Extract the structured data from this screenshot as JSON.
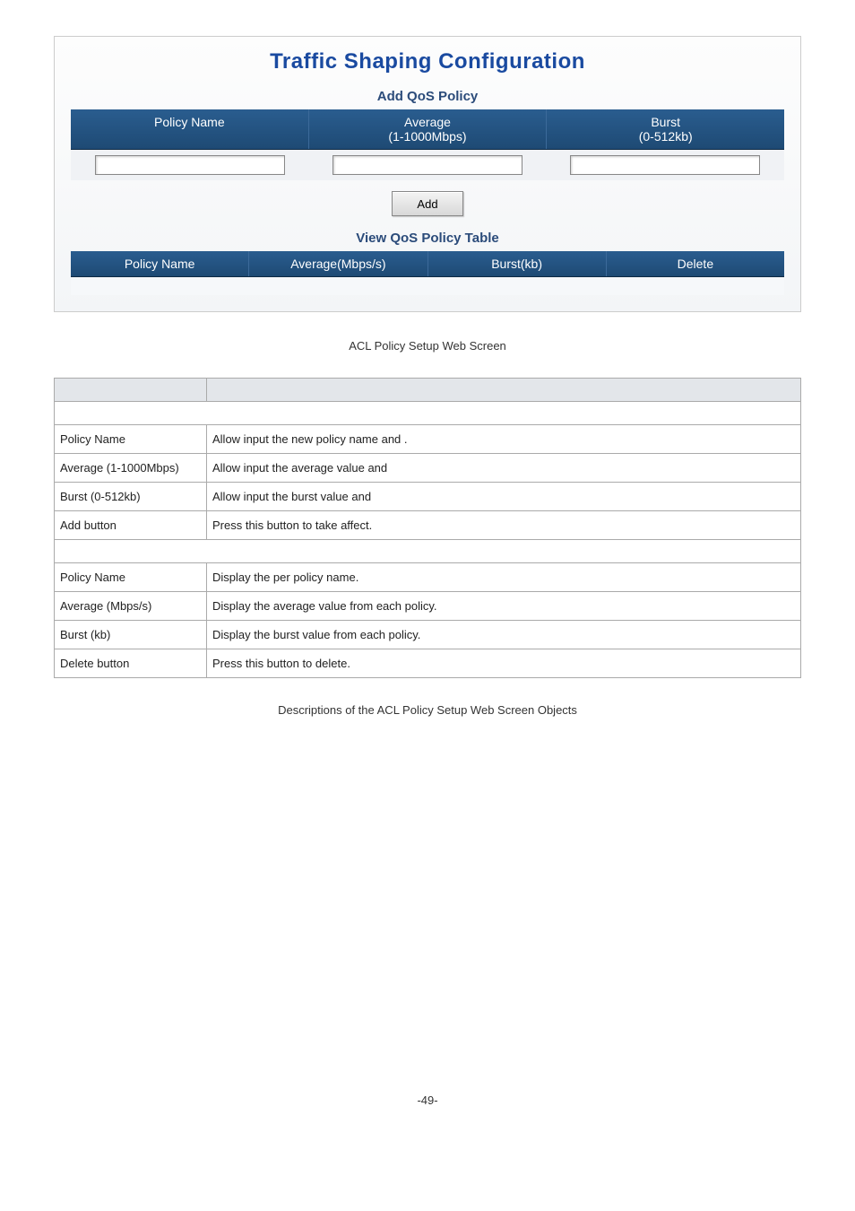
{
  "panel": {
    "title": "Traffic Shaping Configuration",
    "addSection": {
      "heading": "Add QoS Policy",
      "headers": {
        "policyName": "Policy Name",
        "average": "Average\n(1-1000Mbps)",
        "burst": "Burst\n(0-512kb)"
      },
      "addButton": "Add"
    },
    "viewSection": {
      "heading": "View QoS Policy Table",
      "headers": {
        "policyName": "Policy Name",
        "average": "Average(Mbps/s)",
        "burst": "Burst(kb)",
        "delete": "Delete"
      }
    }
  },
  "caption1": "ACL Policy Setup Web Screen",
  "descTable": {
    "rows": [
      {
        "label": "Policy Name",
        "desc": "Allow input the new policy name and                                                                              ."
      },
      {
        "label": "Average (1-1000Mbps)",
        "desc": "Allow input the average value and"
      },
      {
        "label": "Burst (0-512kb)",
        "desc": "Allow input the burst value and"
      },
      {
        "label": "Add button",
        "desc": "Press this button to take affect."
      }
    ],
    "rows2": [
      {
        "label": "Policy Name",
        "desc": "Display the per policy name."
      },
      {
        "label": "Average (Mbps/s)",
        "desc": "Display the average value from each policy."
      },
      {
        "label": "Burst (kb)",
        "desc": "Display the burst value from each policy."
      },
      {
        "label": "Delete button",
        "desc": "Press this button to delete."
      }
    ]
  },
  "caption2": "Descriptions of the ACL Policy Setup Web Screen Objects",
  "pageNumber": "-49-"
}
